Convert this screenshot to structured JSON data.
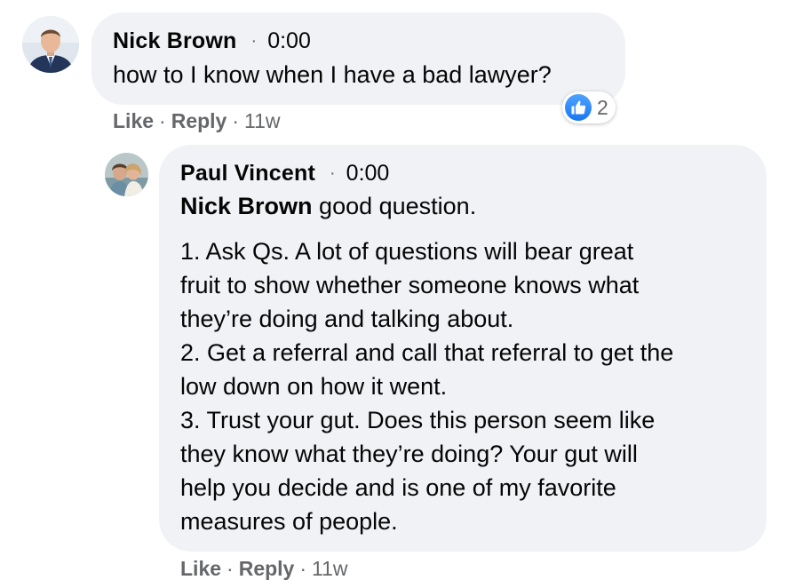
{
  "comments": [
    {
      "author": "Nick Brown",
      "time": "0:00",
      "text": "how to I know when I have a bad lawyer?",
      "reaction_count": "2",
      "actions": {
        "like": "Like",
        "reply": "Reply",
        "age": "11w"
      },
      "avatar_icon": "person-photo"
    }
  ],
  "replies": [
    {
      "author": "Paul Vincent",
      "time": "0:00",
      "mention": "Nick Brown",
      "first_line": "good question.",
      "paragraph_lines": [
        "1. Ask Qs. A lot of questions will bear great",
        "fruit to show whether someone knows what",
        "they’re doing and talking about.",
        "2. Get a referral and call that referral to get the",
        "low down on how it went.",
        "3. Trust your gut. Does this person seem like",
        "they know what they’re doing? Your gut will",
        "help you decide and is one of my favorite",
        "measures of people."
      ],
      "actions": {
        "like": "Like",
        "reply": "Reply",
        "age": "11w"
      },
      "avatar_icon": "couple-photo"
    }
  ],
  "separator": "·",
  "colors": {
    "bubble": "#f0f2f5",
    "secondary_text": "#65676b",
    "like_blue": "#1877f2"
  }
}
